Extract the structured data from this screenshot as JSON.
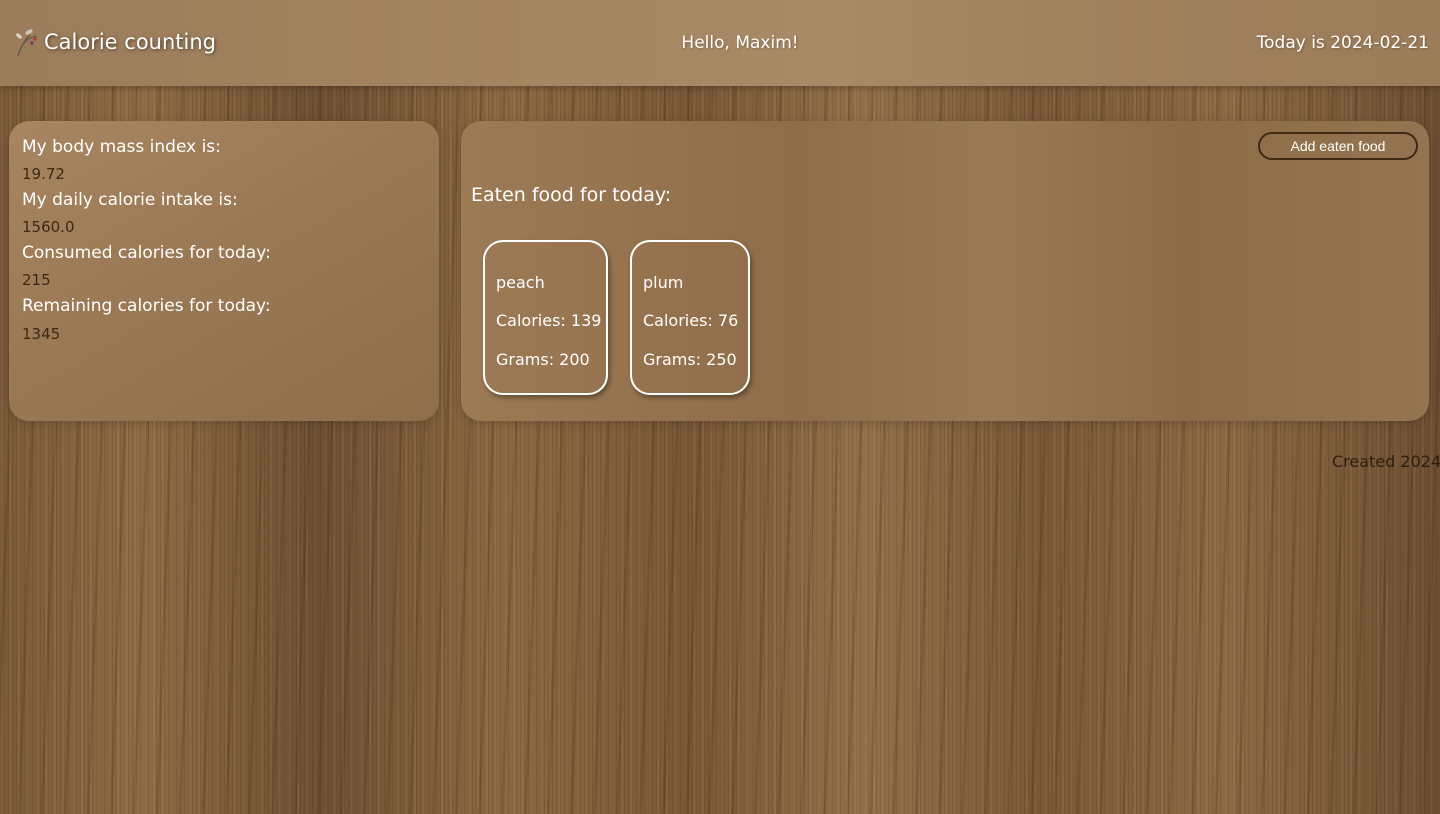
{
  "header": {
    "logo_icon": "fruit-sprig-icon",
    "title": "Calorie counting",
    "greeting": "Hello, Maxim!",
    "today": "Today is 2024-02-21"
  },
  "stats": {
    "bmi_label": "My body mass index is:",
    "bmi_value": "19.72",
    "daily_label": "My daily calorie intake is:",
    "daily_value": "1560.0",
    "consumed_label": "Consumed calories for today:",
    "consumed_value": "215",
    "remaining_label": "Remaining calories for today:",
    "remaining_value": "1345"
  },
  "food": {
    "add_button_label": "Add eaten food",
    "heading": "Eaten food for today:",
    "items": [
      {
        "name": "peach",
        "calories": "Calories: 139",
        "grams": "Grams: 200"
      },
      {
        "name": "plum",
        "calories": "Calories: 76",
        "grams": "Grams: 250"
      }
    ]
  },
  "footer": {
    "text": "Created 2024"
  },
  "colors": {
    "value_text": "#3e2814",
    "button_border": "#3f2a16",
    "card_border": "#ffffff"
  }
}
